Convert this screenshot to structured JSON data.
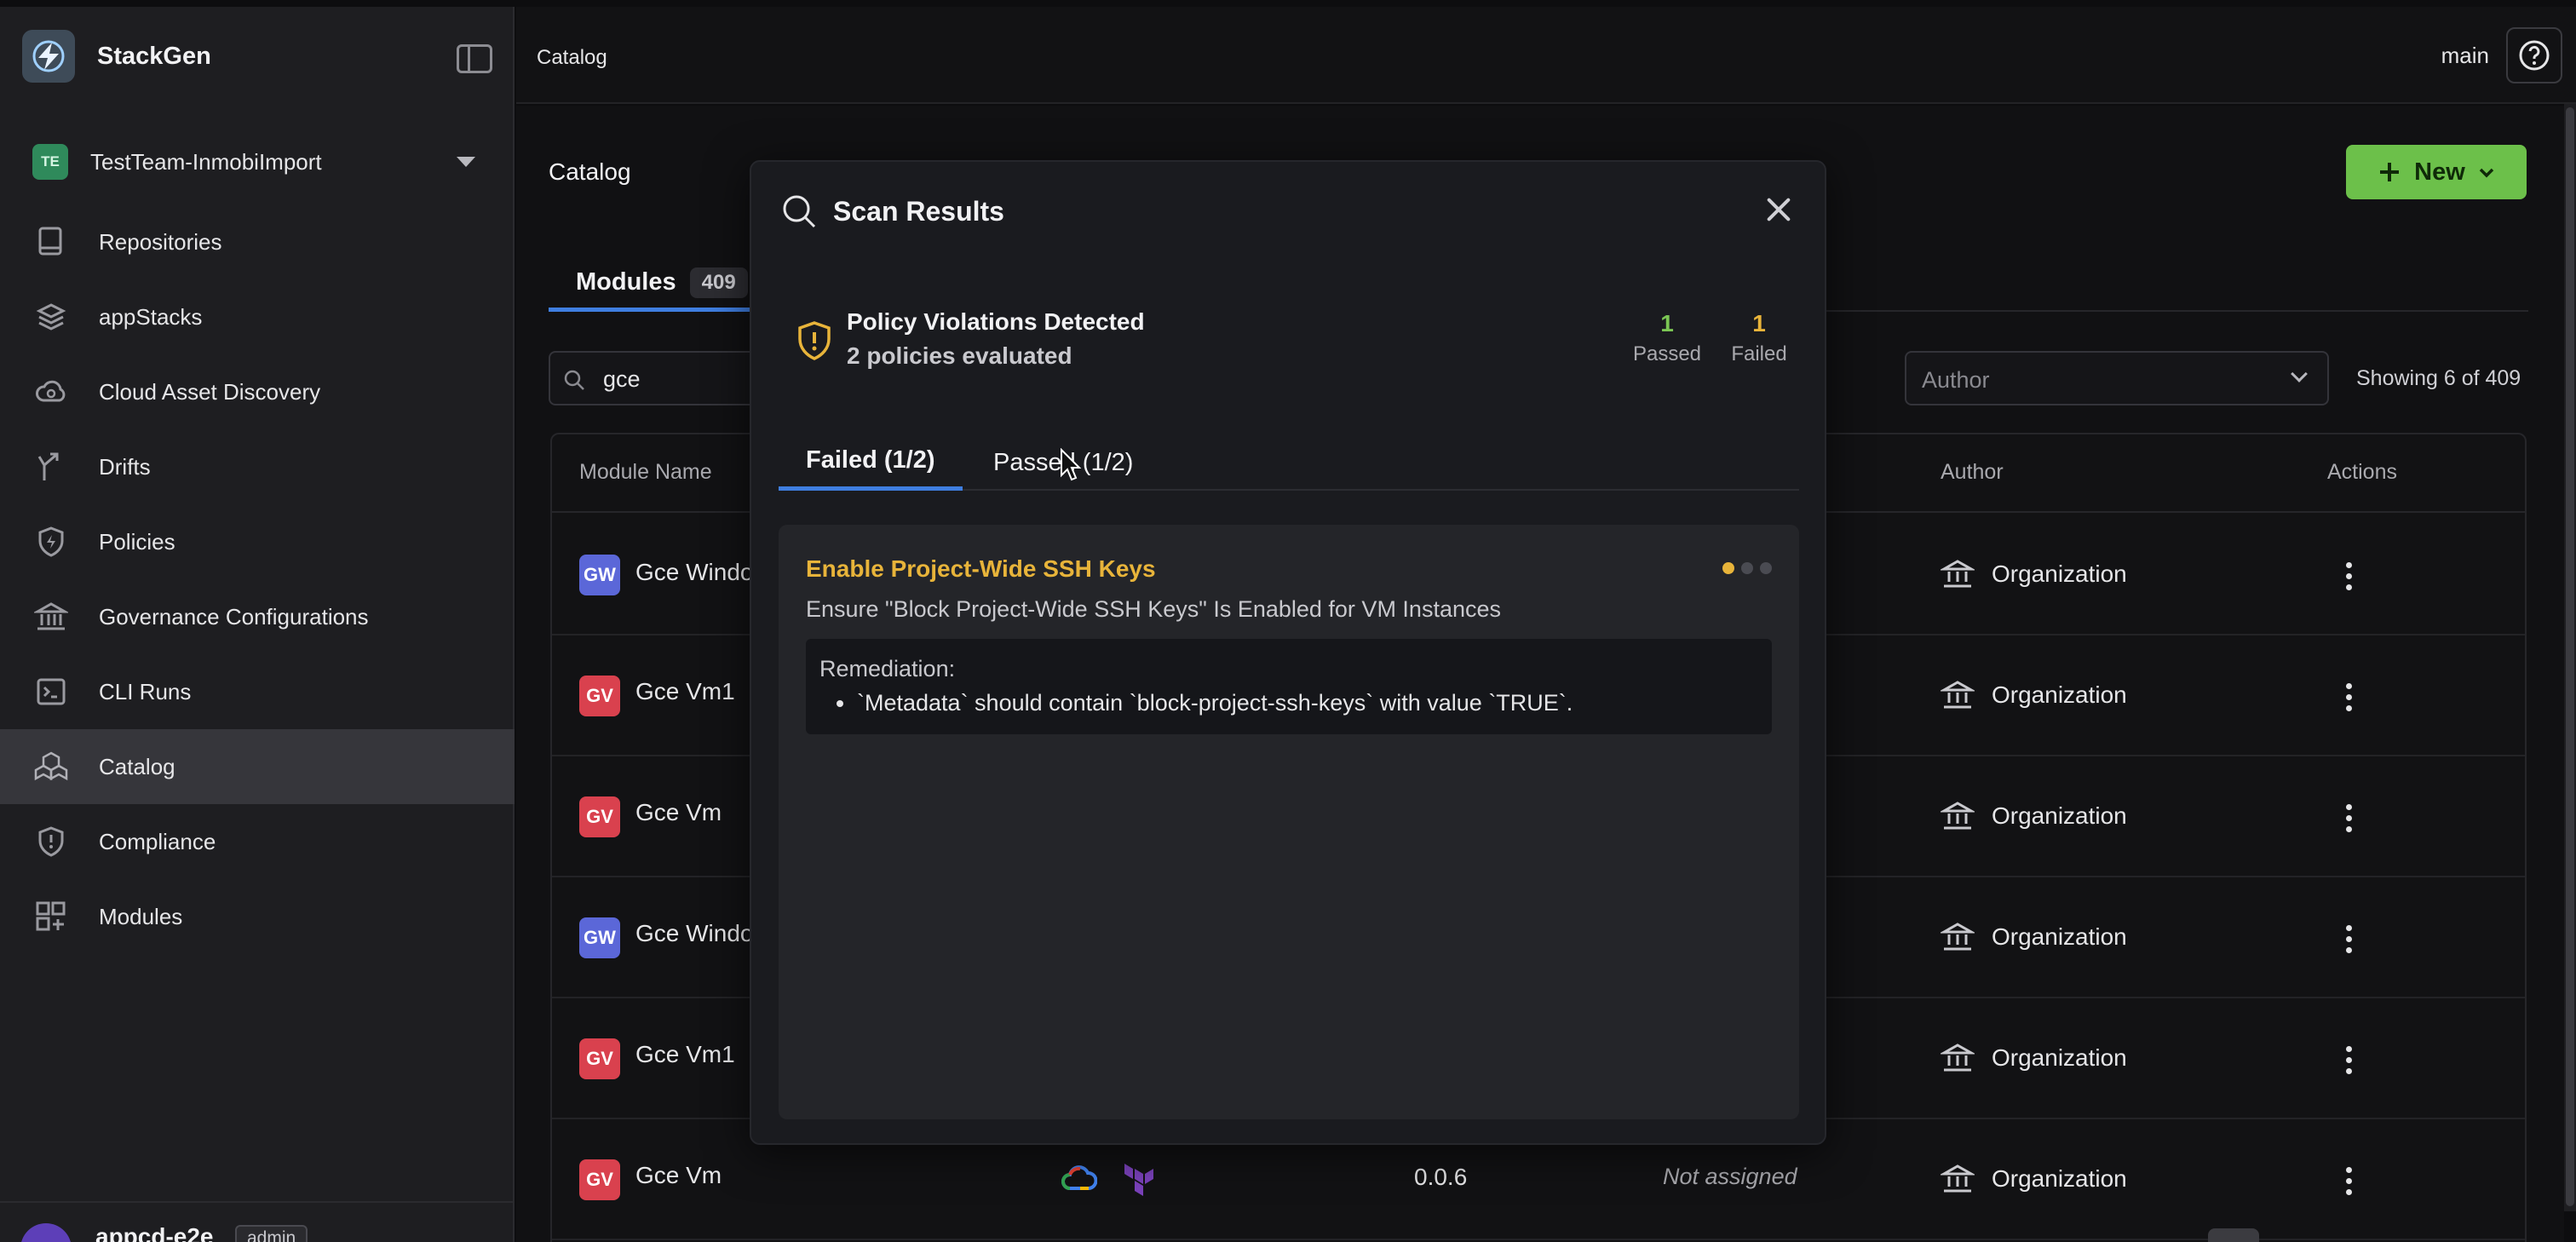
{
  "app": {
    "brand": "StackGen",
    "team": {
      "initials": "TE",
      "name": "TestTeam-InmobiImport"
    },
    "user": {
      "name": "appcd-e2e",
      "role": "admin"
    }
  },
  "sidebar": {
    "items": [
      {
        "label": "Repositories",
        "icon": "repository-icon"
      },
      {
        "label": "appStacks",
        "icon": "layers-icon"
      },
      {
        "label": "Cloud Asset Discovery",
        "icon": "cloud-search-icon"
      },
      {
        "label": "Drifts",
        "icon": "drift-icon"
      },
      {
        "label": "Policies",
        "icon": "policy-shield-icon"
      },
      {
        "label": "Governance Configurations",
        "icon": "bank-icon"
      },
      {
        "label": "CLI Runs",
        "icon": "terminal-icon"
      },
      {
        "label": "Catalog",
        "icon": "catalog-icon",
        "active": true
      },
      {
        "label": "Compliance",
        "icon": "compliance-shield-icon"
      },
      {
        "label": "Modules",
        "icon": "modules-grid-icon"
      }
    ]
  },
  "topbar": {
    "breadcrumb": "Catalog",
    "branch": "main"
  },
  "page": {
    "title": "Catalog",
    "new_button": "New",
    "tab": {
      "label": "Modules",
      "count": "409"
    },
    "search": {
      "value": "gce"
    },
    "author_filter": {
      "placeholder": "Author"
    },
    "showing": "Showing 6 of 409"
  },
  "table": {
    "headers": {
      "name": "Module Name",
      "author": "Author",
      "actions": "Actions"
    },
    "rows": [
      {
        "badge": "GW",
        "name": "Gce Windo",
        "author": "Organization"
      },
      {
        "badge": "GV",
        "name": "Gce Vm1",
        "author": "Organization"
      },
      {
        "badge": "GV",
        "name": "Gce Vm",
        "author": "Organization"
      },
      {
        "badge": "GW",
        "name": "Gce Windo",
        "author": "Organization"
      },
      {
        "badge": "GV",
        "name": "Gce Vm1",
        "author": "Organization"
      },
      {
        "badge": "GV",
        "name": "Gce Vm",
        "author": "Organization",
        "version": "0.0.6",
        "assignment": "Not assigned"
      }
    ]
  },
  "modal": {
    "title": "Scan Results",
    "summary": {
      "title": "Policy Violations Detected",
      "subtitle": "2 policies evaluated"
    },
    "stats": {
      "passed_value": "1",
      "passed_label": "Passed",
      "failed_value": "1",
      "failed_label": "Failed"
    },
    "tabs": {
      "failed": "Failed (1/2)",
      "passed": "Passed (1/2)"
    },
    "violation": {
      "title": "Enable Project-Wide SSH Keys",
      "description": "Ensure \"Block Project-Wide SSH Keys\" Is Enabled for VM Instances",
      "remediation_label": "Remediation:",
      "remediation_item": "`Metadata` should contain `block-project-ssh-keys` with value `TRUE`."
    }
  },
  "colors": {
    "accent_blue": "#3f7ee0",
    "new_button_green": "#6cc04a",
    "warning_yellow": "#e8b43a",
    "passed_green": "#7bc654"
  }
}
